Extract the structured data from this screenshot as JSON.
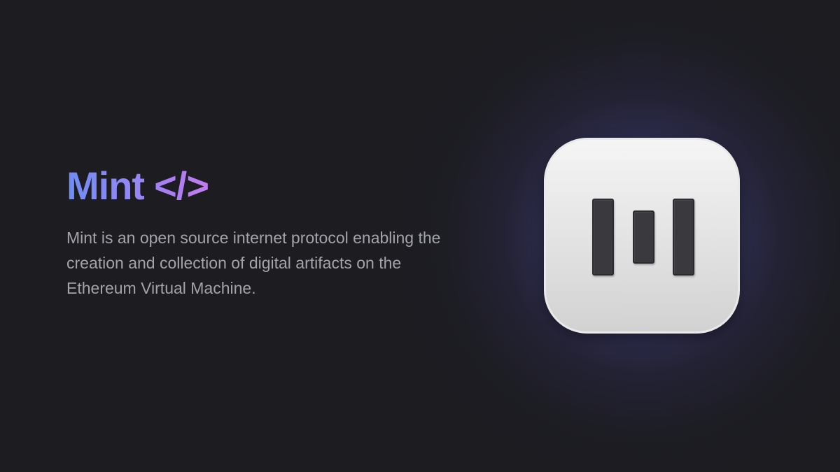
{
  "hero": {
    "title_word": "Mint",
    "title_code": "</>",
    "description": "Mint is an open source internet protocol enabling the creation and collection of digital artifacts on the Ethereum Virtual Machine."
  },
  "logo": {
    "icon": "mint-logo-icon",
    "bars": 3
  },
  "colors": {
    "background": "#1c1c21",
    "title_gradient_start": "#6f8cf7",
    "title_gradient_end": "#c27cf0",
    "description_text": "#a3a3aa",
    "glow": "#5a5cbe",
    "icon_tile": "#ebebeb",
    "icon_bars": "#3a3a3e"
  }
}
